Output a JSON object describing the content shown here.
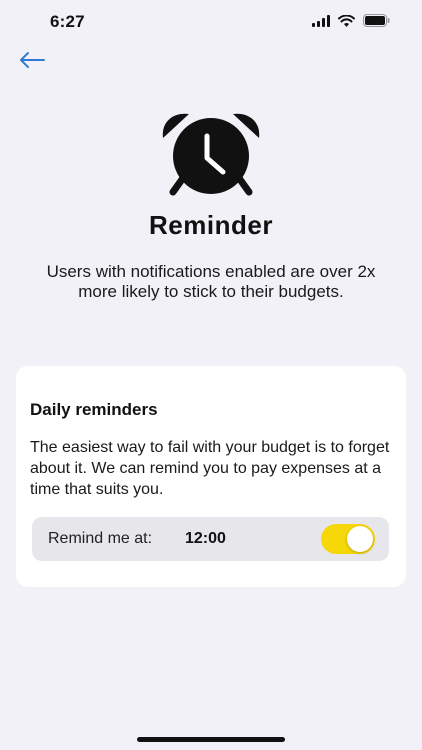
{
  "status_bar": {
    "time": "6:27",
    "icons": [
      "signal-icon",
      "wifi-icon",
      "battery-icon"
    ]
  },
  "nav": {
    "back_icon": "arrow-left-icon",
    "accent_color": "#2f7bd3"
  },
  "hero": {
    "icon": "alarm-clock-icon",
    "title": "Reminder",
    "subtitle": "Users with notifications enabled are over 2x more likely to stick to their budgets."
  },
  "card": {
    "title": "Daily reminders",
    "description": "The easiest way to fail with your budget is to forget about it. We can remind you to pay expenses at a time that suits you.",
    "remind_label": "Remind me at:",
    "remind_time": "12:00",
    "toggle_on": true,
    "toggle_color": "#f6d80a"
  }
}
